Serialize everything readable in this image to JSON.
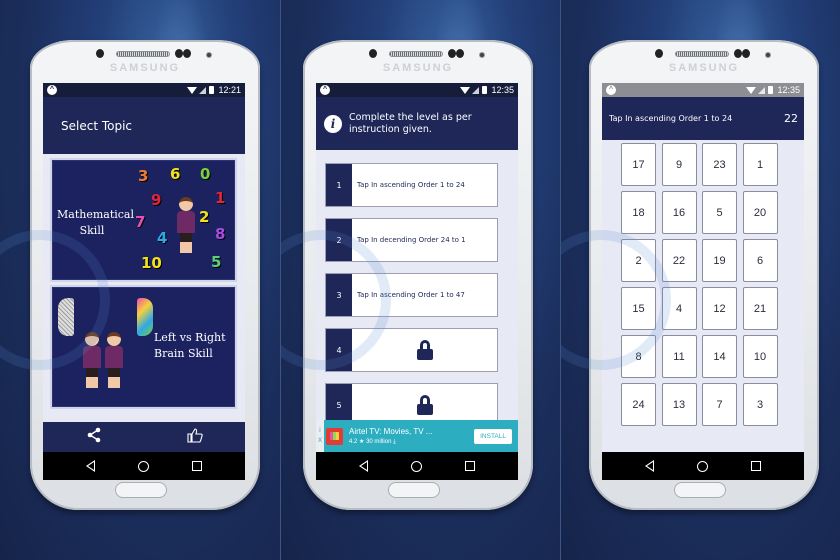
{
  "device_brand": "SAMSUNG",
  "screens": [
    {
      "id": "select-topic",
      "status": {
        "time": "12:21"
      },
      "header_title": "Select Topic",
      "topics": [
        {
          "label_line1": "Mathematical",
          "label_line2": "Skill",
          "numbers": [
            "3",
            "6",
            "0",
            "1",
            "9",
            "2",
            "7",
            "8",
            "4",
            "10",
            "5"
          ]
        },
        {
          "label_line1": "Left vs Right",
          "label_line2": "Brain Skill"
        }
      ],
      "bottom_bar": {
        "share_icon": "share-icon",
        "like_icon": "thumbs-up-icon"
      }
    },
    {
      "id": "levels",
      "status": {
        "time": "12:35"
      },
      "instruction": "Complete the level as per instruction given.",
      "levels": [
        {
          "number": "1",
          "text": "Tap In ascending Order 1 to 24",
          "locked": false
        },
        {
          "number": "2",
          "text": "Tap In decending Order 24 to 1",
          "locked": false
        },
        {
          "number": "3",
          "text": "Tap In ascending Order 1 to 47",
          "locked": false
        },
        {
          "number": "4",
          "text": "",
          "locked": true
        },
        {
          "number": "5",
          "text": "",
          "locked": true
        }
      ],
      "ad": {
        "title": "Airtel TV: Movies, TV ...",
        "rating": "4.2",
        "installs": "30 million",
        "button": "INSTALL",
        "info_icon": "i",
        "close_icon": "X"
      }
    },
    {
      "id": "game",
      "status": {
        "time": "12:35"
      },
      "title": "Tap In ascending Order 1 to 24",
      "counter": "22",
      "tiles": [
        "17",
        "9",
        "23",
        "1",
        "18",
        "16",
        "5",
        "20",
        "2",
        "22",
        "19",
        "6",
        "15",
        "4",
        "12",
        "21",
        "8",
        "11",
        "14",
        "10",
        "24",
        "13",
        "7",
        "3"
      ]
    }
  ],
  "colors": {
    "primary": "#1e2757",
    "background": "#e7e9f5",
    "ad": "#2caec0"
  }
}
